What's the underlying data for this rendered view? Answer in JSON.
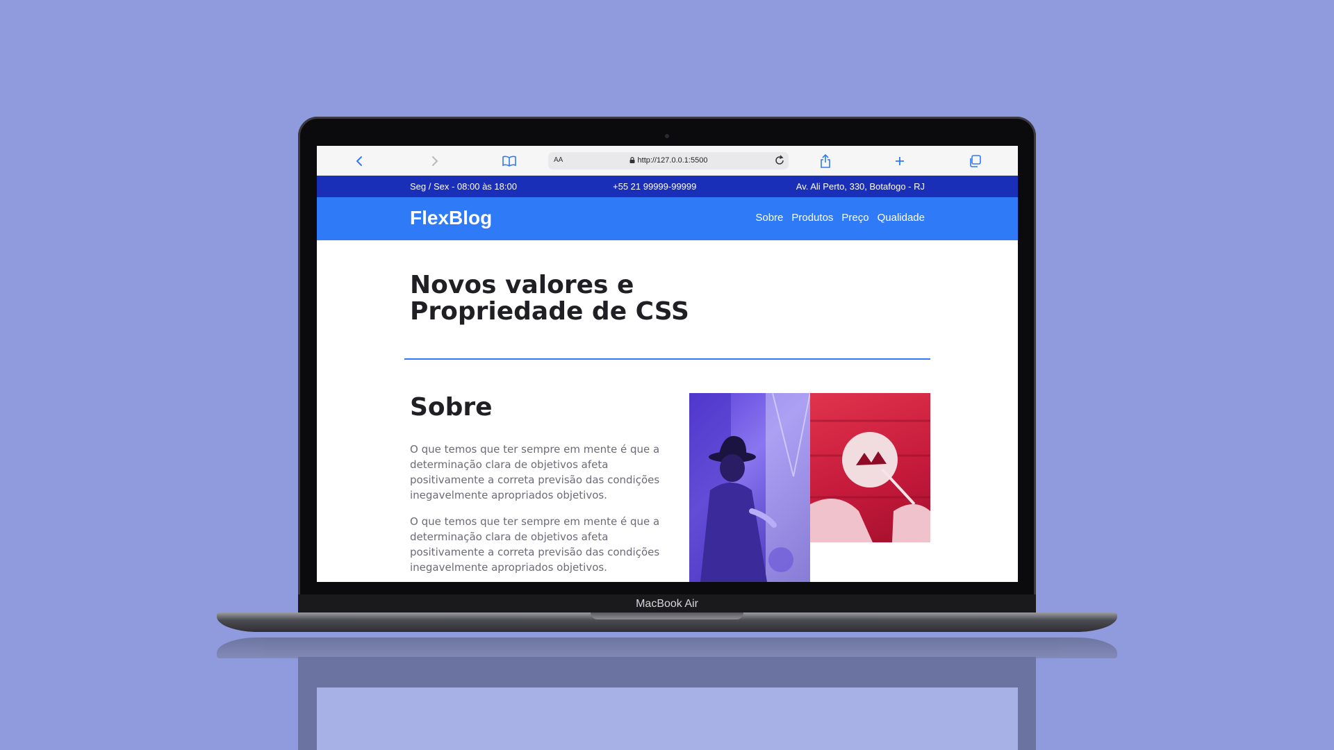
{
  "device": {
    "label": "MacBook Air"
  },
  "browser": {
    "aa_label": "AA",
    "url": "http://127.0.0.1:5500"
  },
  "topbar": {
    "hours": "Seg / Sex - 08:00 às 18:00",
    "phone": "+55 21 99999-99999",
    "address": "Av. Ali Perto, 330, Botafogo - RJ"
  },
  "header": {
    "logo": "FlexBlog",
    "nav": [
      "Sobre",
      "Produtos",
      "Preço",
      "Qualidade"
    ]
  },
  "hero": {
    "title_line1": "Novos valores e",
    "title_line2": "Propriedade de CSS"
  },
  "about": {
    "title": "Sobre",
    "paragraphs": [
      "O que temos que ter sempre em mente é que a determinação clara de objetivos afeta positivamente a correta previsão das condições inegavelmente apropriados objetivos.",
      "O que temos que ter sempre em mente é que a determinação clara de objetivos afeta positivamente a correta previsão das condições inegavelmente apropriados objetivos."
    ]
  },
  "colors": {
    "background": "#8f9bdc",
    "topbar": "#1a2fb8",
    "header": "#2f7af7",
    "accent": "#2f7af7",
    "image_purple": "#5b3fd8",
    "image_red": "#d9264a"
  },
  "icons": [
    "back-chevron-icon",
    "forward-chevron-icon",
    "bookmarks-icon",
    "lock-icon",
    "reload-icon",
    "share-icon",
    "new-tab-icon",
    "tabs-icon"
  ]
}
